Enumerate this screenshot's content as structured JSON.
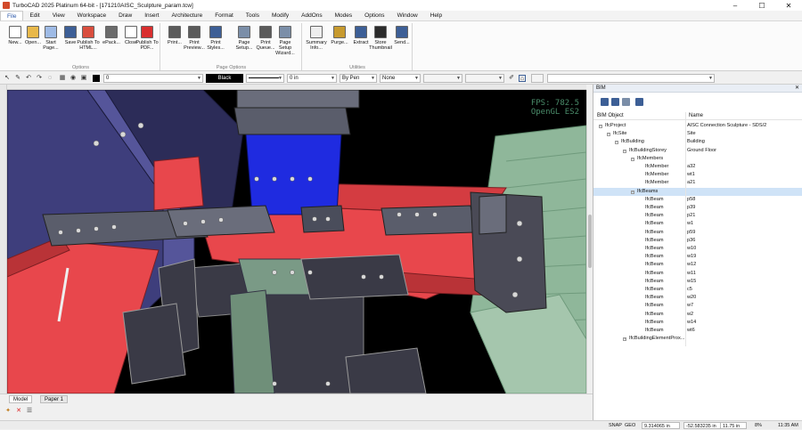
{
  "window": {
    "title": "TurboCAD 2025 Platinum 64-bit - [171210AISC_Sculpture_param.tcw]",
    "controls": [
      "–",
      "☐",
      "✕"
    ]
  },
  "menu": [
    "File",
    "Edit",
    "View",
    "Workspace",
    "Draw",
    "Insert",
    "Architecture",
    "Format",
    "Tools",
    "Modify",
    "AddOns",
    "Modes",
    "Options",
    "Window",
    "Help"
  ],
  "ribbon": {
    "groups": [
      {
        "caption": "Options",
        "buttons": [
          {
            "label": "New...",
            "icon": "new-file-icon",
            "color": "#ffffff"
          },
          {
            "label": "Open...",
            "icon": "open-folder-icon",
            "color": "#e8b84a"
          },
          {
            "label": "Start Page...",
            "icon": "start-page-icon",
            "color": "#9fbbe6"
          },
          {
            "label": "Save",
            "icon": "save-icon",
            "color": "#3d5f96"
          },
          {
            "label": "Publish To HTML...",
            "icon": "publish-html-icon",
            "color": "#d94e3e"
          },
          {
            "label": "ePack...",
            "icon": "epack-icon",
            "color": "#6b6b6b"
          },
          {
            "label": "Close",
            "icon": "close-doc-icon",
            "color": "#ffffff"
          },
          {
            "label": "Publish To PDF...",
            "icon": "pdf-icon",
            "color": "#d92f2f"
          }
        ]
      },
      {
        "caption": "Page Options",
        "buttons": [
          {
            "label": "Print...",
            "icon": "printer-icon",
            "color": "#5b5b5b"
          },
          {
            "label": "Print Preview...",
            "icon": "print-preview-icon",
            "color": "#5b5b5b"
          },
          {
            "label": "Print Styles...",
            "icon": "print-styles-icon",
            "color": "#3d5f96"
          },
          {
            "label": "Page Setup...",
            "icon": "page-setup-icon",
            "color": "#7b8ea8"
          },
          {
            "label": "Print Queue...",
            "icon": "print-queue-icon",
            "color": "#5b5b5b"
          },
          {
            "label": "Page Setup Wizard...",
            "icon": "page-wizard-icon",
            "color": "#7b8ea8"
          }
        ]
      },
      {
        "caption": "Utilities",
        "buttons": [
          {
            "label": "Summary Info...",
            "icon": "summary-icon",
            "color": "#eeeeee"
          },
          {
            "label": "Purge...",
            "icon": "purge-icon",
            "color": "#c79a2f"
          },
          {
            "label": "Extract",
            "icon": "extract-icon",
            "color": "#3d5f96"
          },
          {
            "label": "Store Thumbnail",
            "icon": "thumbnail-icon",
            "color": "#2b2b2b"
          },
          {
            "label": "Send...",
            "icon": "send-mail-icon",
            "color": "#3d5f96"
          }
        ]
      }
    ]
  },
  "properties": {
    "layer": "0",
    "color": "Black",
    "width": "0 in",
    "linestyle": "By Pen",
    "fill": "None"
  },
  "viewport": {
    "fps": "FPS: 782.5",
    "renderer": "OpenGL ES2"
  },
  "tabs": [
    "Model",
    "Paper 1"
  ],
  "status": {
    "snap": "SNAP",
    "geo": "GEO",
    "x": "9.314065 in",
    "y": "-52.583235 in",
    "z": "11.75 in",
    "zoom": "8%",
    "time": "11:35 AM"
  },
  "bim": {
    "title": "BIM",
    "col_object": "BIM Object",
    "col_name": "Name",
    "rows": [
      {
        "obj": "IfcProject",
        "name": "AISC Connection Sculpture - SDS/2",
        "level": 0,
        "toggle": "−"
      },
      {
        "obj": "IfcSite",
        "name": "Site",
        "level": 1,
        "toggle": "−"
      },
      {
        "obj": "IfcBuilding",
        "name": "Building",
        "level": 2,
        "toggle": "−"
      },
      {
        "obj": "IfcBuildingStorey",
        "name": "Ground Floor",
        "level": 3,
        "toggle": "−"
      },
      {
        "obj": "IfcMembers",
        "name": "",
        "level": 4,
        "toggle": "−"
      },
      {
        "obj": "IfcMember",
        "name": "a32",
        "level": 5,
        "toggle": ""
      },
      {
        "obj": "IfcMember",
        "name": "wt1",
        "level": 5,
        "toggle": ""
      },
      {
        "obj": "IfcMember",
        "name": "a21",
        "level": 5,
        "toggle": ""
      },
      {
        "obj": "IfcBeams",
        "name": "",
        "level": 4,
        "toggle": "−",
        "selected": true
      },
      {
        "obj": "IfcBeam",
        "name": "p58",
        "level": 5,
        "toggle": ""
      },
      {
        "obj": "IfcBeam",
        "name": "p39",
        "level": 5,
        "toggle": ""
      },
      {
        "obj": "IfcBeam",
        "name": "p21",
        "level": 5,
        "toggle": ""
      },
      {
        "obj": "IfcBeam",
        "name": "w1",
        "level": 5,
        "toggle": ""
      },
      {
        "obj": "IfcBeam",
        "name": "p59",
        "level": 5,
        "toggle": ""
      },
      {
        "obj": "IfcBeam",
        "name": "p36",
        "level": 5,
        "toggle": ""
      },
      {
        "obj": "IfcBeam",
        "name": "w10",
        "level": 5,
        "toggle": ""
      },
      {
        "obj": "IfcBeam",
        "name": "w19",
        "level": 5,
        "toggle": ""
      },
      {
        "obj": "IfcBeam",
        "name": "w12",
        "level": 5,
        "toggle": ""
      },
      {
        "obj": "IfcBeam",
        "name": "w11",
        "level": 5,
        "toggle": ""
      },
      {
        "obj": "IfcBeam",
        "name": "w15",
        "level": 5,
        "toggle": ""
      },
      {
        "obj": "IfcBeam",
        "name": "c5",
        "level": 5,
        "toggle": ""
      },
      {
        "obj": "IfcBeam",
        "name": "w20",
        "level": 5,
        "toggle": ""
      },
      {
        "obj": "IfcBeam",
        "name": "w7",
        "level": 5,
        "toggle": ""
      },
      {
        "obj": "IfcBeam",
        "name": "w2",
        "level": 5,
        "toggle": ""
      },
      {
        "obj": "IfcBeam",
        "name": "w14",
        "level": 5,
        "toggle": ""
      },
      {
        "obj": "IfcBeam",
        "name": "wt6",
        "level": 5,
        "toggle": ""
      },
      {
        "obj": "IfcBuildingElementProx...",
        "name": "",
        "level": 3,
        "toggle": "+"
      }
    ]
  },
  "colors": {
    "beam_red": "#e8474c",
    "plate_dark": "#3a3a46",
    "steel_grey": "#5a5d6b",
    "column_blue": "#1f2be0",
    "wall_green": "#8fb79a",
    "slab_purple": "#4a4a8c",
    "selection": "#cfe3f7"
  }
}
